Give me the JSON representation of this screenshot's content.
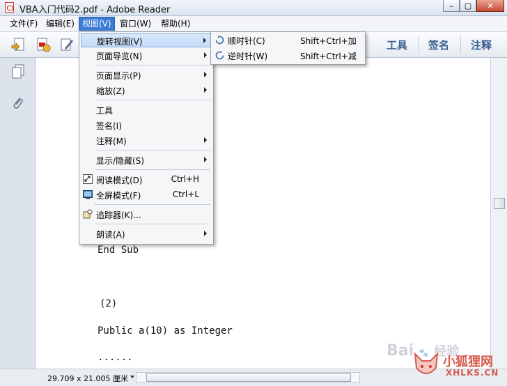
{
  "window": {
    "title": "VBA入门代码2.pdf - Adobe Reader",
    "min": "–",
    "max": "▢",
    "close": "✕"
  },
  "menubar": {
    "items": [
      "文件(F)",
      "编辑(E)",
      "视图(V)",
      "窗口(W)",
      "帮助(H)"
    ]
  },
  "toolbar": {
    "tools": "工具",
    "sign": "签名",
    "comment": "注释"
  },
  "view_menu": {
    "items": [
      {
        "label": "旋转视图(V)"
      },
      {
        "label": "页面导览(N)"
      },
      {
        "label": "页面显示(P)"
      },
      {
        "label": "缩放(Z)"
      },
      {
        "label": "工具"
      },
      {
        "label": "签名(I)"
      },
      {
        "label": "注释(M)"
      },
      {
        "label": "显示/隐藏(S)"
      },
      {
        "label": "阅读模式(D)",
        "shortcut": "Ctrl+H"
      },
      {
        "label": "全屏模式(F)",
        "shortcut": "Ctrl+L"
      },
      {
        "label": "追踪器(K)..."
      },
      {
        "label": "朗读(A)"
      }
    ]
  },
  "rotate_submenu": {
    "items": [
      {
        "label": "顺时针(C)",
        "shortcut": "Shift+Ctrl+加"
      },
      {
        "label": "逆时针(W)",
        "shortcut": "Shift+Ctrl+减"
      }
    ]
  },
  "document": {
    "lines": [
      "End Sub",
      "(2)",
      "Public a(10) as Integer",
      "......"
    ]
  },
  "statusbar": {
    "page_size": "29.709 x 21.005 厘米"
  },
  "watermarks": {
    "baidu": "Bai",
    "baidu_suffix": "经验",
    "site_cn": "小狐狸网",
    "site_en": "XHLKS.CN"
  },
  "colors": {
    "menu_active": "#3b7bd6",
    "menu_highlight": "#c3dbf7",
    "toolbar_text": "#3a5f8f"
  }
}
